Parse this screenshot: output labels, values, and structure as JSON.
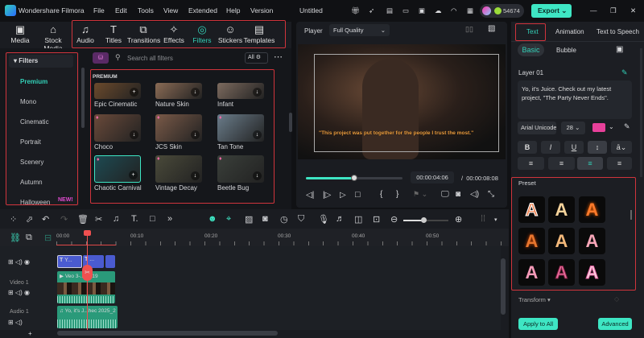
{
  "app": {
    "title": "Wondershare Filmora",
    "project": "Untitled",
    "credits": "54674",
    "export_label": "Export"
  },
  "menu": [
    "File",
    "Edit",
    "Tools",
    "View",
    "Extended",
    "Help",
    "Version"
  ],
  "tabs": [
    {
      "label": "Media",
      "icon": "▣"
    },
    {
      "label": "Stock Media",
      "icon": "⌂"
    },
    {
      "label": "Audio",
      "icon": "♫"
    },
    {
      "label": "Titles",
      "icon": "T"
    },
    {
      "label": "Transitions",
      "icon": "⧉"
    },
    {
      "label": "Effects",
      "icon": "✧"
    },
    {
      "label": "Filters",
      "icon": "◎"
    },
    {
      "label": "Stickers",
      "icon": "☺"
    },
    {
      "label": "Templates",
      "icon": "▤"
    }
  ],
  "sidebar": {
    "header": "Filters",
    "items": [
      "Premium",
      "Mono",
      "Cinematic",
      "Portrait",
      "Scenery",
      "Autumn",
      "Halloween"
    ],
    "new_badge": "NEW!"
  },
  "filters": {
    "search_placeholder": "Search all filters",
    "all_label": "All",
    "section": "PREMIUM",
    "items": [
      {
        "name": "Epic Cinematic",
        "color": "#6b4a2c"
      },
      {
        "name": "Nature Skin",
        "color": "#8a6b55"
      },
      {
        "name": "Infant",
        "color": "#7c6a5e"
      },
      {
        "name": "Choco",
        "color": "#6a4a3a"
      },
      {
        "name": "JCS Skin",
        "color": "#7a5a48"
      },
      {
        "name": "Tan Tone",
        "color": "#6a7c8a"
      },
      {
        "name": "Chaotic Carnival",
        "color": "#1d4a52"
      },
      {
        "name": "Vintage Decay",
        "color": "#4a4a3a"
      },
      {
        "name": "Beetle Bug",
        "color": "#3a3f3a"
      }
    ]
  },
  "player": {
    "label": "Player",
    "quality": "Full Quality",
    "caption": "\"This project was put together for the people I trust the most.\"",
    "current_time": "00:00:04:06",
    "total_time": "00:00:08:08",
    "progress": 0.5
  },
  "right": {
    "tabs": [
      "Text",
      "Animation",
      "Text to Speech"
    ],
    "subtabs": [
      "Basic",
      "Bubble"
    ],
    "layer": "Layer 01",
    "text": "Yo, it's Juice. Check out my latest project, \"The Party Never Ends\".",
    "font": "Arial Unicode",
    "size": "28",
    "color": "#e8409a",
    "preset_label": "Preset",
    "transform_label": "Transform",
    "apply_all": "Apply to All",
    "advanced": "Advanced"
  },
  "timeline": {
    "ticks": [
      "00:00",
      "00:10",
      "00:20",
      "00:30",
      "00:40",
      "00:50"
    ],
    "tracks": [
      "Video 1",
      "Audio 1"
    ],
    "clips": {
      "title1": "Y...",
      "title2": "...",
      "video": "Veo 3-...25-19",
      "audio": "Yo, it's J...hec 2025_2"
    },
    "zoom": 0.45
  }
}
